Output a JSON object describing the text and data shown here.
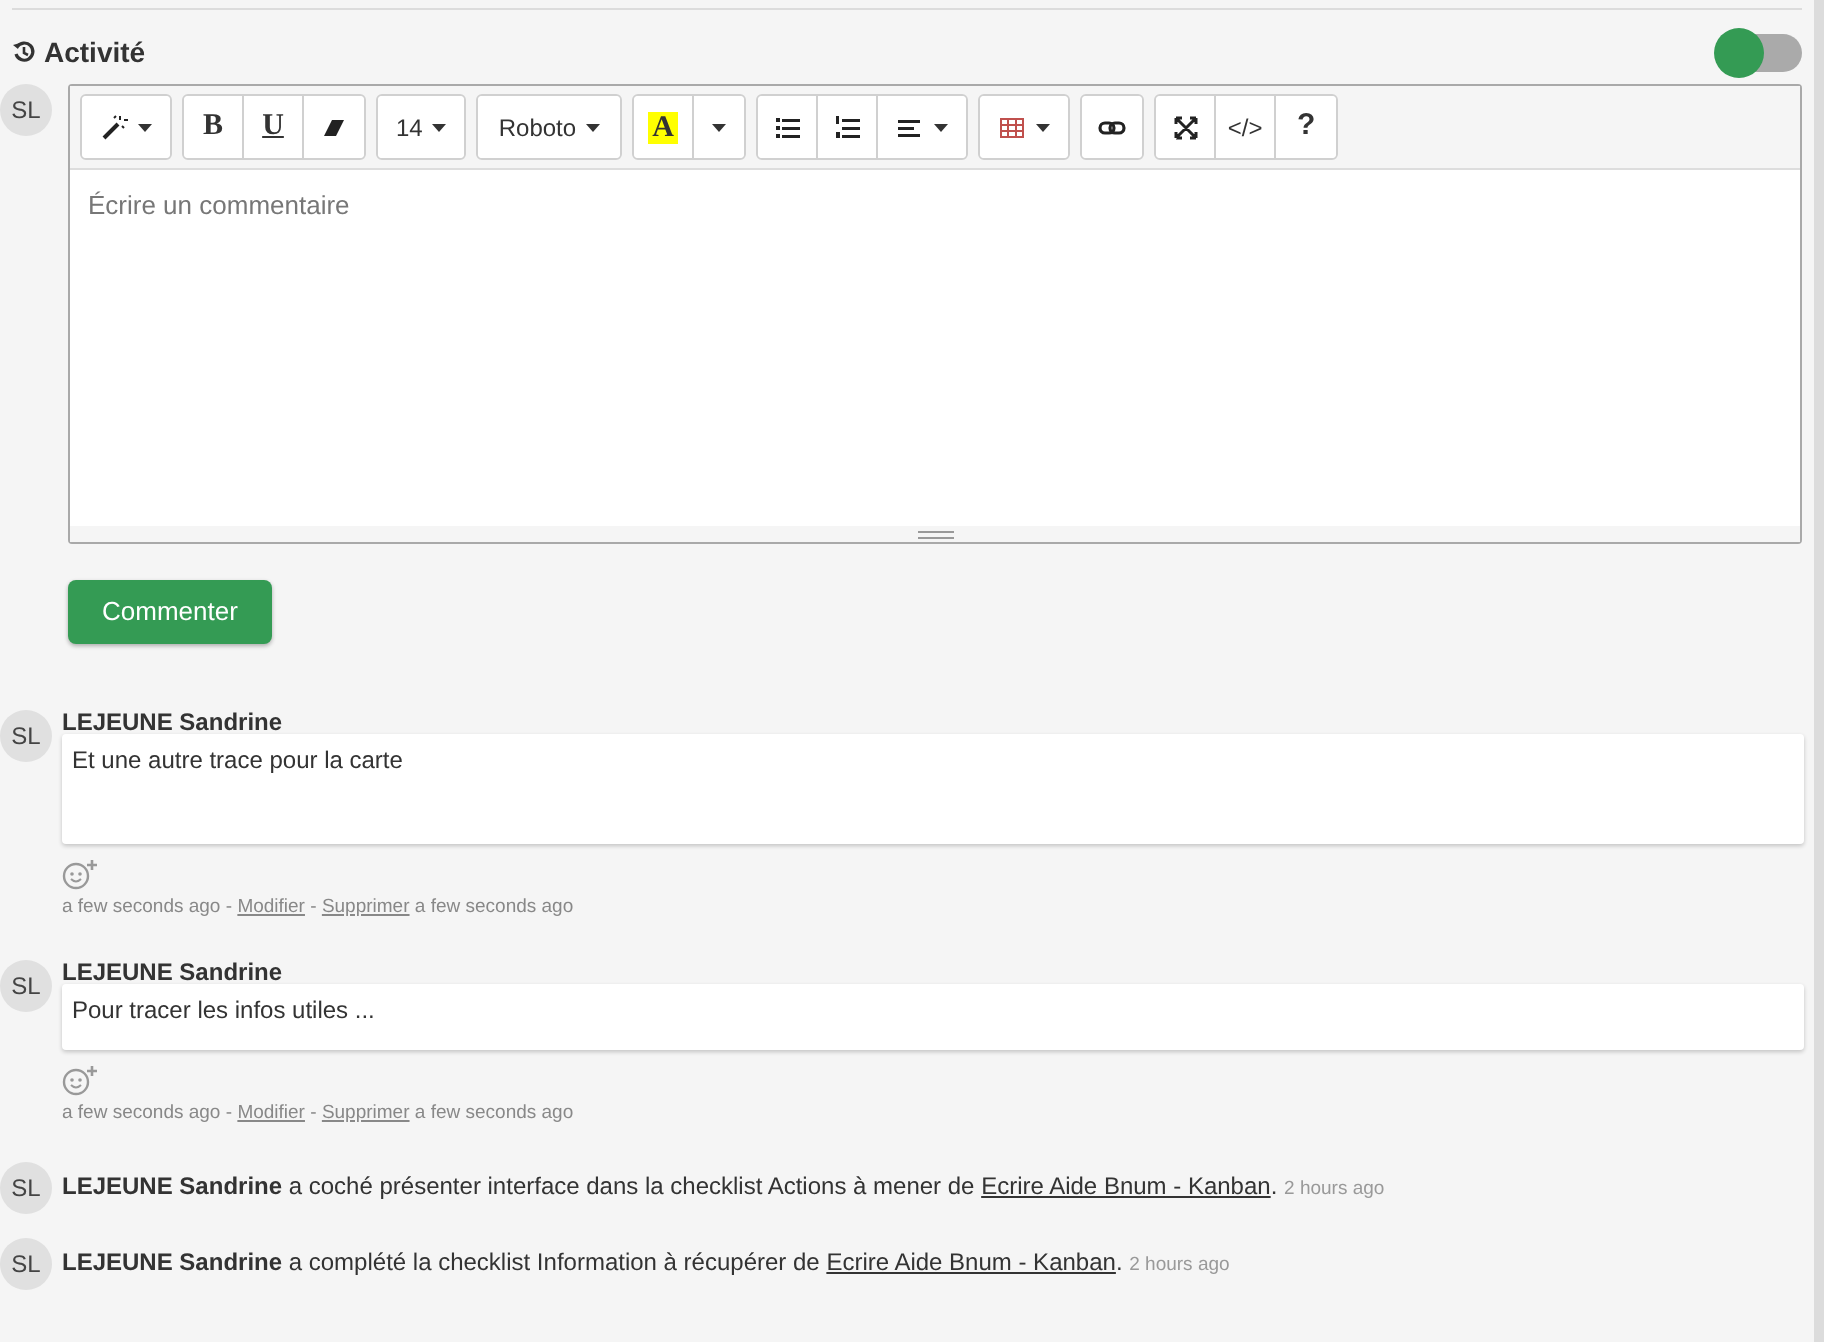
{
  "header": {
    "title": "Activité",
    "toggle": {
      "on": false
    }
  },
  "editor": {
    "avatar": "SL",
    "placeholder": "Écrire un commentaire",
    "toolbar": [
      {
        "items": [
          {
            "caret": true
          }
        ]
      },
      {
        "items": [
          {
            "label": "B",
            "caret": false
          },
          {
            "label": "U",
            "caret": false
          },
          {
            "caret": false
          }
        ]
      },
      {
        "items": [
          {
            "label": "14",
            "caret": true
          }
        ]
      },
      {
        "items": [
          {
            "label": "Roboto",
            "caret": true
          }
        ]
      },
      {
        "items": [
          {
            "label": "A",
            "caret": false
          },
          {
            "caret": true
          }
        ]
      },
      {
        "items": [
          {
            "caret": false
          },
          {
            "caret": false
          },
          {
            "caret": true
          }
        ]
      },
      {
        "items": [
          {
            "caret": true
          }
        ]
      },
      {
        "items": [
          {
            "caret": false
          }
        ]
      },
      {
        "items": [
          {
            "caret": false
          },
          {
            "label": "</>",
            "caret": false
          },
          {
            "label": "?",
            "caret": false
          }
        ]
      }
    ],
    "submit": "Commenter"
  },
  "activity": [
    {
      "kind": "comment",
      "avatar": "SL",
      "author": "LEJEUNE Sandrine",
      "text": "Et une autre trace pour la carte",
      "tall": true,
      "time": "a few seconds ago",
      "sep": "-",
      "edit": "Modifier",
      "sep2": "-",
      "delete": "Supprimer",
      "edited": "a few seconds ago"
    },
    {
      "kind": "comment",
      "avatar": "SL",
      "author": "LEJEUNE Sandrine",
      "text": "Pour tracer les infos utiles ...",
      "tall": false,
      "time": "a few seconds ago",
      "sep": "-",
      "edit": "Modifier",
      "sep2": "-",
      "delete": "Supprimer",
      "edited": "a few seconds ago"
    },
    {
      "kind": "event",
      "avatar": "SL",
      "author": "LEJEUNE Sandrine",
      "text": "a coché présenter interface dans la checklist Actions à mener de",
      "link": "Ecrire Aide Bnum - Kanban",
      "end": ".",
      "time": "2 hours ago"
    },
    {
      "kind": "event",
      "avatar": "SL",
      "author": "LEJEUNE Sandrine",
      "text": "a complété la checklist Information à récupérer de",
      "link": "Ecrire Aide Bnum - Kanban",
      "end": ".",
      "time": "2 hours ago"
    }
  ]
}
